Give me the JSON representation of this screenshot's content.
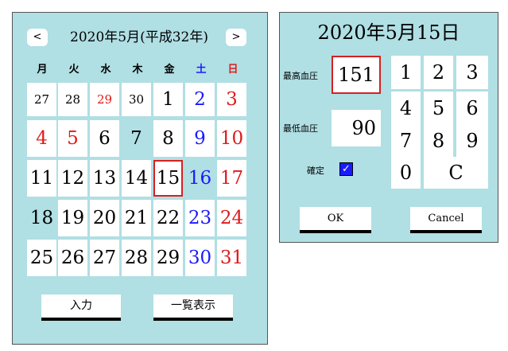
{
  "calendar": {
    "title": "2020年5月(平成32年)",
    "prev_label": "<",
    "next_label": ">",
    "weekdays": [
      {
        "label": "月",
        "color": "#000000"
      },
      {
        "label": "火",
        "color": "#000000"
      },
      {
        "label": "水",
        "color": "#000000"
      },
      {
        "label": "木",
        "color": "#000000"
      },
      {
        "label": "金",
        "color": "#000000"
      },
      {
        "label": "土",
        "color": "#1a1aff"
      },
      {
        "label": "日",
        "color": "#e01a1a"
      }
    ],
    "weeks": [
      [
        {
          "day": "27",
          "color": "#000000",
          "small": true
        },
        {
          "day": "28",
          "color": "#000000",
          "small": true
        },
        {
          "day": "29",
          "color": "#e01a1a",
          "small": true
        },
        {
          "day": "30",
          "color": "#000000",
          "small": true
        },
        {
          "day": "1",
          "color": "#000000"
        },
        {
          "day": "2",
          "color": "#1a1aff"
        },
        {
          "day": "3",
          "color": "#e01a1a"
        }
      ],
      [
        {
          "day": "4",
          "color": "#e01a1a"
        },
        {
          "day": "5",
          "color": "#e01a1a"
        },
        {
          "day": "6",
          "color": "#000000"
        },
        {
          "day": "7",
          "color": "#000000",
          "blank": true
        },
        {
          "day": "8",
          "color": "#000000"
        },
        {
          "day": "9",
          "color": "#1a1aff"
        },
        {
          "day": "10",
          "color": "#e01a1a"
        }
      ],
      [
        {
          "day": "11",
          "color": "#000000"
        },
        {
          "day": "12",
          "color": "#000000"
        },
        {
          "day": "13",
          "color": "#000000"
        },
        {
          "day": "14",
          "color": "#000000"
        },
        {
          "day": "15",
          "color": "#000000",
          "selected": true
        },
        {
          "day": "16",
          "color": "#1a1aff",
          "blank": true
        },
        {
          "day": "17",
          "color": "#e01a1a"
        }
      ],
      [
        {
          "day": "18",
          "color": "#000000",
          "blank": true
        },
        {
          "day": "19",
          "color": "#000000"
        },
        {
          "day": "20",
          "color": "#000000"
        },
        {
          "day": "21",
          "color": "#000000"
        },
        {
          "day": "22",
          "color": "#000000"
        },
        {
          "day": "23",
          "color": "#1a1aff"
        },
        {
          "day": "24",
          "color": "#e01a1a"
        }
      ],
      [
        {
          "day": "25",
          "color": "#000000"
        },
        {
          "day": "26",
          "color": "#000000"
        },
        {
          "day": "27",
          "color": "#000000"
        },
        {
          "day": "28",
          "color": "#000000"
        },
        {
          "day": "29",
          "color": "#000000"
        },
        {
          "day": "30",
          "color": "#1a1aff"
        },
        {
          "day": "31",
          "color": "#e01a1a"
        }
      ]
    ],
    "input_label": "入力",
    "list_label": "一覧表示"
  },
  "bp": {
    "date_title": "2020年5月15日",
    "systolic_label": "最高血圧",
    "systolic_value": "151",
    "diastolic_label": "最低血圧",
    "diastolic_value": "90",
    "confirm_label": "確定",
    "confirm_checked": true,
    "keys": [
      "1",
      "2",
      "3",
      "4",
      "5",
      "6",
      "7",
      "8",
      "9",
      "0",
      "C"
    ],
    "ok_label": "OK",
    "cancel_label": "Cancel"
  },
  "colors": {
    "panel_bg": "#b0dfe4",
    "selected_border": "#d62020",
    "saturday": "#1a1aff",
    "sunday": "#e01a1a",
    "checkbox": "#1a1aff"
  }
}
